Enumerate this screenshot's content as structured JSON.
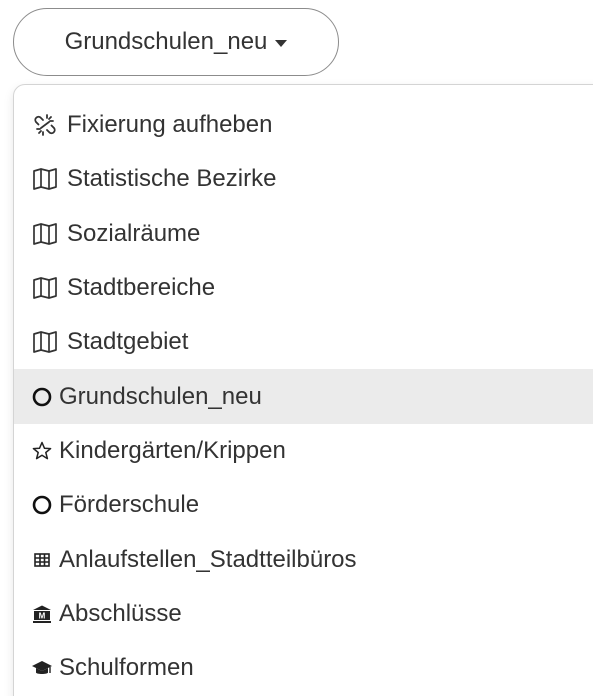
{
  "dropdown": {
    "selected_label": "Grundschulen_neu"
  },
  "menu": {
    "items": [
      {
        "label": "Fixierung aufheben",
        "icon": "unlink-icon"
      },
      {
        "label": "Statistische Bezirke",
        "icon": "map-icon"
      },
      {
        "label": "Sozialräume",
        "icon": "map-icon"
      },
      {
        "label": "Stadtbereiche",
        "icon": "map-icon"
      },
      {
        "label": "Stadtgebiet",
        "icon": "map-icon"
      },
      {
        "label": "Grundschulen_neu",
        "icon": "circle-icon",
        "active": true
      },
      {
        "label": "Kindergärten/Krippen",
        "icon": "star-icon"
      },
      {
        "label": "Förderschule",
        "icon": "circle-icon"
      },
      {
        "label": "Anlaufstellen_Stadtteilbüros",
        "icon": "grid-icon"
      },
      {
        "label": "Abschlüsse",
        "icon": "institution-icon"
      },
      {
        "label": "Schulformen",
        "icon": "graduation-cap-icon"
      }
    ]
  }
}
